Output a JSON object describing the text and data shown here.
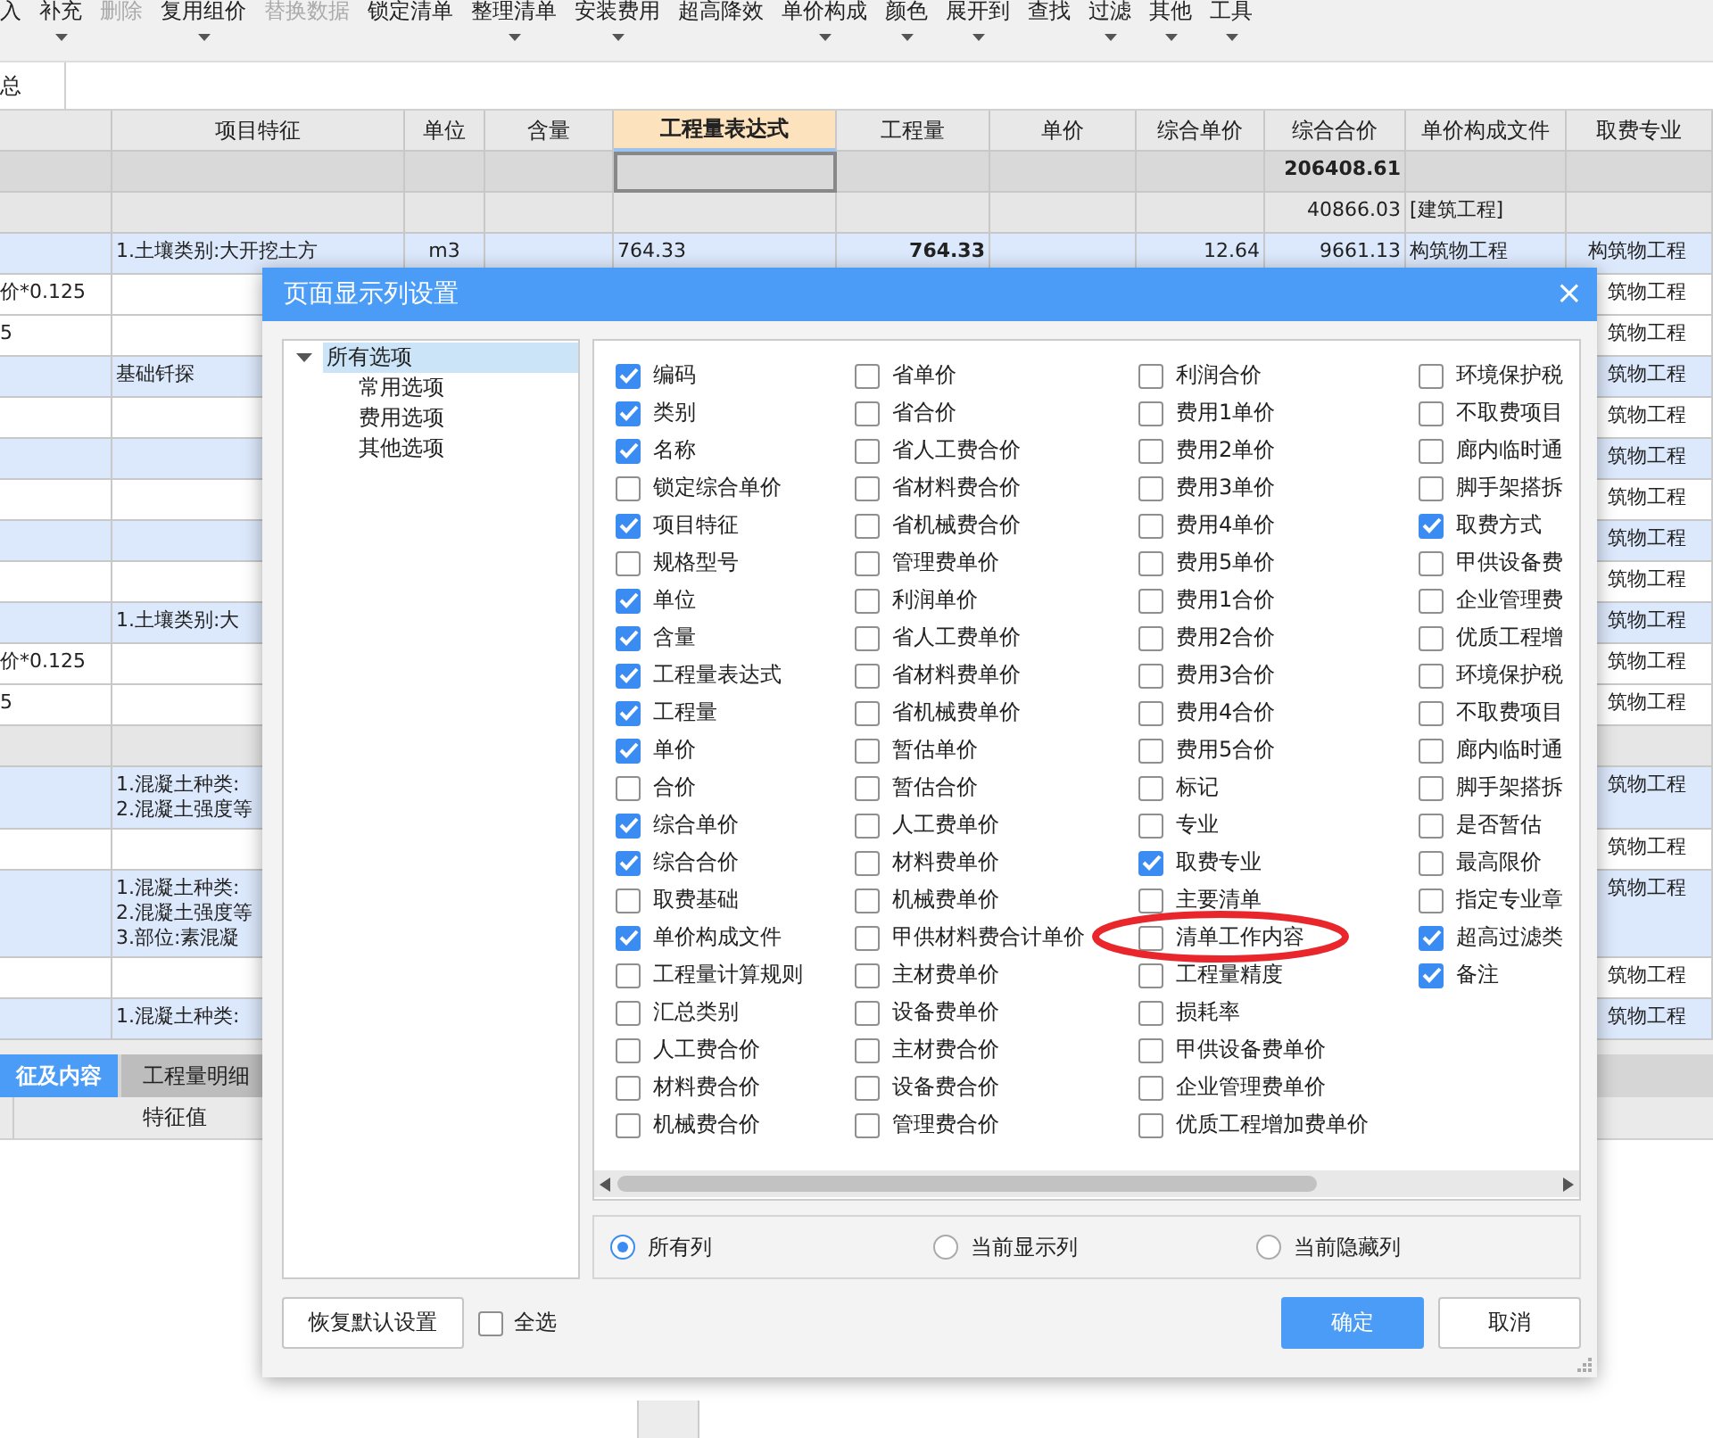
{
  "toolbar": {
    "items": [
      {
        "label": "入",
        "disabled": false,
        "has_menu": false
      },
      {
        "label": "补充",
        "disabled": false,
        "has_menu": true
      },
      {
        "label": "删除",
        "disabled": true,
        "has_menu": false
      },
      {
        "label": "复用组价",
        "disabled": false,
        "has_menu": true
      },
      {
        "label": "替换数据",
        "disabled": true,
        "has_menu": false
      },
      {
        "label": "锁定清单",
        "disabled": false,
        "has_menu": false
      },
      {
        "label": "整理清单",
        "disabled": false,
        "has_menu": true
      },
      {
        "label": "安装费用",
        "disabled": false,
        "has_menu": true
      },
      {
        "label": "超高降效",
        "disabled": false,
        "has_menu": false
      },
      {
        "label": "单价构成",
        "disabled": false,
        "has_menu": true
      },
      {
        "label": "颜色",
        "disabled": false,
        "has_menu": true
      },
      {
        "label": "展开到",
        "disabled": false,
        "has_menu": true
      },
      {
        "label": "查找",
        "disabled": false,
        "has_menu": false
      },
      {
        "label": "过滤",
        "disabled": false,
        "has_menu": true
      },
      {
        "label": "其他",
        "disabled": false,
        "has_menu": true
      },
      {
        "label": "工具",
        "disabled": false,
        "has_menu": true
      }
    ]
  },
  "view_tabs": [
    {
      "label": "总",
      "selected": true
    }
  ],
  "table": {
    "columns": [
      {
        "highlighted": false
      },
      {
        "label": "项目特征",
        "highlighted": false
      },
      {
        "label": "单位",
        "highlighted": false
      },
      {
        "label": "含量",
        "highlighted": false
      },
      {
        "label": "工程量表达式",
        "highlighted": true
      },
      {
        "label": "工程量",
        "highlighted": false
      },
      {
        "label": "单价",
        "highlighted": false
      },
      {
        "label": "综合单价",
        "highlighted": false
      },
      {
        "label": "综合合价",
        "highlighted": false
      },
      {
        "label": "单价构成文件",
        "highlighted": false
      },
      {
        "label": "取费专业",
        "highlighted": false
      }
    ],
    "rows": [
      {
        "kind": "summary",
        "focused": true,
        "cells": {
          "composite_total": "206408.61"
        }
      },
      {
        "kind": "section",
        "focused": false,
        "cells": {
          "composite_total": "40866.03",
          "price_file": "[建筑工程]"
        }
      },
      {
        "kind": "item",
        "focused": false,
        "cells": {
          "feature": "1.土壤类别:大开挖土方",
          "unit": "m3",
          "expression": "764.33",
          "quantity": "764.33",
          "composite_unit_price": "12.64",
          "composite_total": "9661.13",
          "price_file": "构筑物工程",
          "fee_specialty": "构筑物工程"
        }
      },
      {
        "kind": "detail",
        "focused": false,
        "cells": {
          "column_1": "价*0.125",
          "fee_specialty": "筑物工程"
        }
      },
      {
        "kind": "detail",
        "focused": false,
        "cells": {
          "column_1": "5",
          "fee_specialty": "筑物工程"
        }
      },
      {
        "kind": "item",
        "focused": false,
        "cells": {
          "feature": "基础钎探",
          "fee_specialty": "筑物工程"
        }
      },
      {
        "kind": "detail",
        "focused": false,
        "cells": {
          "fee_specialty": "筑物工程"
        }
      },
      {
        "kind": "item",
        "focused": false,
        "cells": {
          "fee_specialty": "筑物工程"
        }
      },
      {
        "kind": "detail",
        "focused": false,
        "cells": {
          "fee_specialty": "筑物工程"
        }
      },
      {
        "kind": "item",
        "focused": false,
        "cells": {
          "fee_specialty": "筑物工程"
        }
      },
      {
        "kind": "detail",
        "focused": false,
        "cells": {
          "fee_specialty": "筑物工程"
        }
      },
      {
        "kind": "item",
        "focused": false,
        "cells": {
          "feature": "1.土壤类别:大",
          "fee_specialty": "筑物工程"
        }
      },
      {
        "kind": "detail",
        "focused": false,
        "cells": {
          "column_1": "价*0.125",
          "fee_specialty": "筑物工程"
        }
      },
      {
        "kind": "detail",
        "focused": false,
        "cells": {
          "column_1": "5",
          "fee_specialty": "筑物工程"
        }
      },
      {
        "kind": "section",
        "focused": false,
        "cells": {}
      },
      {
        "kind": "item",
        "focused": false,
        "cells": {
          "feature": [
            "1.混凝土种类:",
            "2.混凝土强度等"
          ],
          "fee_specialty": "筑物工程"
        }
      },
      {
        "kind": "detail",
        "focused": false,
        "cells": {
          "fee_specialty": "筑物工程"
        }
      },
      {
        "kind": "item",
        "focused": false,
        "cells": {
          "feature": [
            "1.混凝土种类:",
            "2.混凝土强度等",
            "3.部位:素混凝"
          ],
          "fee_specialty": "筑物工程"
        }
      },
      {
        "kind": "detail",
        "focused": false,
        "cells": {
          "fee_specialty": "筑物工程"
        }
      },
      {
        "kind": "item",
        "focused": false,
        "cells": {
          "feature": "1.混凝土种类:",
          "fee_specialty": "筑物工程"
        }
      }
    ]
  },
  "bottom_panel": {
    "tabs": [
      {
        "label": "征及内容",
        "selected": true
      },
      {
        "label": "工程量明细",
        "selected": false
      }
    ],
    "columns": [
      "特征值"
    ]
  },
  "dialog": {
    "title": "页面显示列设置",
    "close": "×",
    "tree": [
      {
        "label": "所有选项",
        "expanded": true,
        "selected": true,
        "children": [
          {
            "label": "常用选项",
            "selected": false
          },
          {
            "label": "费用选项",
            "selected": false
          },
          {
            "label": "其他选项",
            "selected": false
          }
        ]
      }
    ],
    "checklist": {
      "columns": [
        {
          "options": [
            {
              "label": "编码",
              "checked": true
            },
            {
              "label": "类别",
              "checked": true
            },
            {
              "label": "名称",
              "checked": true
            },
            {
              "label": "锁定综合单价",
              "checked": false
            },
            {
              "label": "项目特征",
              "checked": true
            },
            {
              "label": "规格型号",
              "checked": false
            },
            {
              "label": "单位",
              "checked": true
            },
            {
              "label": "含量",
              "checked": true
            },
            {
              "label": "工程量表达式",
              "checked": true
            },
            {
              "label": "工程量",
              "checked": true
            },
            {
              "label": "单价",
              "checked": true
            },
            {
              "label": "合价",
              "checked": false
            },
            {
              "label": "综合单价",
              "checked": true
            },
            {
              "label": "综合合价",
              "checked": true
            },
            {
              "label": "取费基础",
              "checked": false
            },
            {
              "label": "单价构成文件",
              "checked": true
            },
            {
              "label": "工程量计算规则",
              "checked": false
            },
            {
              "label": "汇总类别",
              "checked": false
            },
            {
              "label": "人工费合价",
              "checked": false
            },
            {
              "label": "材料费合价",
              "checked": false
            },
            {
              "label": "机械费合价",
              "checked": false
            }
          ]
        },
        {
          "options": [
            {
              "label": "省单价",
              "checked": false
            },
            {
              "label": "省合价",
              "checked": false
            },
            {
              "label": "省人工费合价",
              "checked": false
            },
            {
              "label": "省材料费合价",
              "checked": false
            },
            {
              "label": "省机械费合价",
              "checked": false
            },
            {
              "label": "管理费单价",
              "checked": false
            },
            {
              "label": "利润单价",
              "checked": false
            },
            {
              "label": "省人工费单价",
              "checked": false
            },
            {
              "label": "省材料费单价",
              "checked": false
            },
            {
              "label": "省机械费单价",
              "checked": false
            },
            {
              "label": "暂估单价",
              "checked": false
            },
            {
              "label": "暂估合价",
              "checked": false
            },
            {
              "label": "人工费单价",
              "checked": false
            },
            {
              "label": "材料费单价",
              "checked": false
            },
            {
              "label": "机械费单价",
              "checked": false
            },
            {
              "label": "甲供材料费合计单价",
              "checked": false
            },
            {
              "label": "主材费单价",
              "checked": false
            },
            {
              "label": "设备费单价",
              "checked": false
            },
            {
              "label": "主材费合价",
              "checked": false
            },
            {
              "label": "设备费合价",
              "checked": false
            },
            {
              "label": "管理费合价",
              "checked": false
            }
          ]
        },
        {
          "options": [
            {
              "label": "利润合价",
              "checked": false
            },
            {
              "label": "费用1单价",
              "checked": false
            },
            {
              "label": "费用2单价",
              "checked": false
            },
            {
              "label": "费用3单价",
              "checked": false
            },
            {
              "label": "费用4单价",
              "checked": false
            },
            {
              "label": "费用5单价",
              "checked": false
            },
            {
              "label": "费用1合价",
              "checked": false
            },
            {
              "label": "费用2合价",
              "checked": false
            },
            {
              "label": "费用3合价",
              "checked": false
            },
            {
              "label": "费用4合价",
              "checked": false
            },
            {
              "label": "费用5合价",
              "checked": false
            },
            {
              "label": "标记",
              "checked": false
            },
            {
              "label": "专业",
              "checked": false
            },
            {
              "label": "取费专业",
              "checked": true
            },
            {
              "label": "主要清单",
              "checked": false
            },
            {
              "label": "清单工作内容",
              "checked": false
            },
            {
              "label": "工程量精度",
              "checked": false
            },
            {
              "label": "损耗率",
              "checked": false
            },
            {
              "label": "甲供设备费单价",
              "checked": false
            },
            {
              "label": "企业管理费单价",
              "checked": false
            },
            {
              "label": "优质工程增加费单价",
              "checked": false
            }
          ]
        },
        {
          "options": [
            {
              "label": "环境保护税",
              "checked": false
            },
            {
              "label": "不取费项目",
              "checked": false
            },
            {
              "label": "廊内临时通",
              "checked": false
            },
            {
              "label": "脚手架搭拆",
              "checked": false
            },
            {
              "label": "取费方式",
              "checked": true
            },
            {
              "label": "甲供设备费",
              "checked": false
            },
            {
              "label": "企业管理费",
              "checked": false
            },
            {
              "label": "优质工程增",
              "checked": false
            },
            {
              "label": "环境保护税",
              "checked": false
            },
            {
              "label": "不取费项目",
              "checked": false
            },
            {
              "label": "廊内临时通",
              "checked": false
            },
            {
              "label": "脚手架搭拆",
              "checked": false
            },
            {
              "label": "是否暂估",
              "checked": false
            },
            {
              "label": "最高限价",
              "checked": false
            },
            {
              "label": "指定专业章",
              "checked": false
            },
            {
              "label": "超高过滤类",
              "checked": true
            },
            {
              "label": "备注",
              "checked": true
            }
          ]
        }
      ]
    },
    "filter": [
      {
        "label": "所有列",
        "selected": true
      },
      {
        "label": "当前显示列",
        "selected": false
      },
      {
        "label": "当前隐藏列",
        "selected": false
      }
    ],
    "reset_button": "恢复默认设置",
    "select_all": {
      "label": "全选",
      "checked": false
    },
    "ok_button": "确定",
    "cancel_button": "取消"
  }
}
